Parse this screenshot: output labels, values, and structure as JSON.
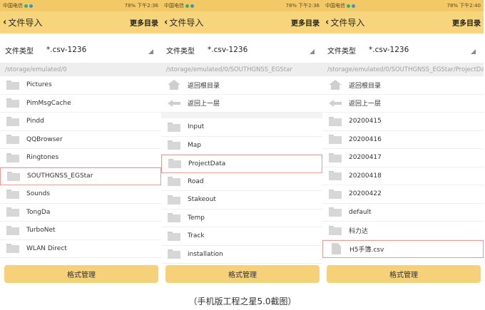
{
  "phones": [
    {
      "status": {
        "carrier": "中国电信",
        "right": "78% 下午2:36"
      },
      "header": {
        "back_label": "文件导入",
        "more_label": "更多目录"
      },
      "filetype": {
        "label": "文件类型",
        "value": "*.csv-1236"
      },
      "path": "/storage/emulated/0",
      "items": [
        {
          "icon": "folder-icon",
          "label": "Pictures"
        },
        {
          "icon": "folder-icon",
          "label": "PimMsgCache"
        },
        {
          "icon": "folder-icon",
          "label": "Pindd"
        },
        {
          "icon": "folder-icon",
          "label": "QQBrowser"
        },
        {
          "icon": "folder-icon",
          "label": "Ringtones"
        },
        {
          "icon": "folder-icon",
          "label": "SOUTHGNSS_EGStar",
          "selected": true
        },
        {
          "icon": "folder-icon",
          "label": "Sounds"
        },
        {
          "icon": "folder-icon",
          "label": "TongDa"
        },
        {
          "icon": "folder-icon",
          "label": "TurboNet"
        },
        {
          "icon": "folder-icon",
          "label": "WLAN Direct"
        }
      ],
      "action_label": "格式管理"
    },
    {
      "status": {
        "carrier": "中国电信",
        "right": "78% 下午2:36"
      },
      "header": {
        "back_label": "文件导入",
        "more_label": "更多目录"
      },
      "filetype": {
        "label": "文件类型",
        "value": "*.csv-1236"
      },
      "path": "/storage/emulated/0/SOUTHGNSS_EGStar",
      "items": [
        {
          "icon": "home-icon",
          "label": "返回根目录"
        },
        {
          "icon": "back-arrow-icon",
          "label": "返回上一层"
        },
        {
          "separator": true
        },
        {
          "icon": "folder-icon",
          "label": "Input"
        },
        {
          "icon": "folder-icon",
          "label": "Map"
        },
        {
          "icon": "folder-icon",
          "label": "ProjectData",
          "selected": true
        },
        {
          "icon": "folder-icon",
          "label": "Road"
        },
        {
          "icon": "folder-icon",
          "label": "Stakeout"
        },
        {
          "icon": "folder-icon",
          "label": "Temp"
        },
        {
          "icon": "folder-icon",
          "label": "Track"
        },
        {
          "icon": "folder-icon",
          "label": "installation"
        }
      ],
      "action_label": "格式管理"
    },
    {
      "status": {
        "carrier": "中国电信",
        "right": "78% 下午2:40"
      },
      "header": {
        "back_label": "文件导入",
        "more_label": "更多目录"
      },
      "filetype": {
        "label": "文件类型",
        "value": "*.csv-1236"
      },
      "path": "/storage/emulated/0/SOUTHGNSS_EGStar/ProjectData",
      "items": [
        {
          "icon": "home-icon",
          "label": "返回根目录"
        },
        {
          "icon": "back-arrow-icon",
          "label": "返回上一层"
        },
        {
          "icon": "folder-icon",
          "label": "20200415"
        },
        {
          "icon": "folder-icon",
          "label": "20200416"
        },
        {
          "icon": "folder-icon",
          "label": "20200417"
        },
        {
          "icon": "folder-icon",
          "label": "20200418"
        },
        {
          "icon": "folder-icon",
          "label": "20200422"
        },
        {
          "icon": "folder-icon",
          "label": "default"
        },
        {
          "icon": "folder-icon",
          "label": "科力达"
        },
        {
          "icon": "file-icon",
          "label": "H5手簿.csv",
          "selected": true
        }
      ],
      "action_label": "格式管理"
    }
  ],
  "caption": "（手机版工程之星5.0截图）",
  "colors": {
    "status_bar": "#f3c866",
    "title_bar": "#f6d57c",
    "button": "#f6d17a",
    "selection_border": "#e99a94"
  }
}
